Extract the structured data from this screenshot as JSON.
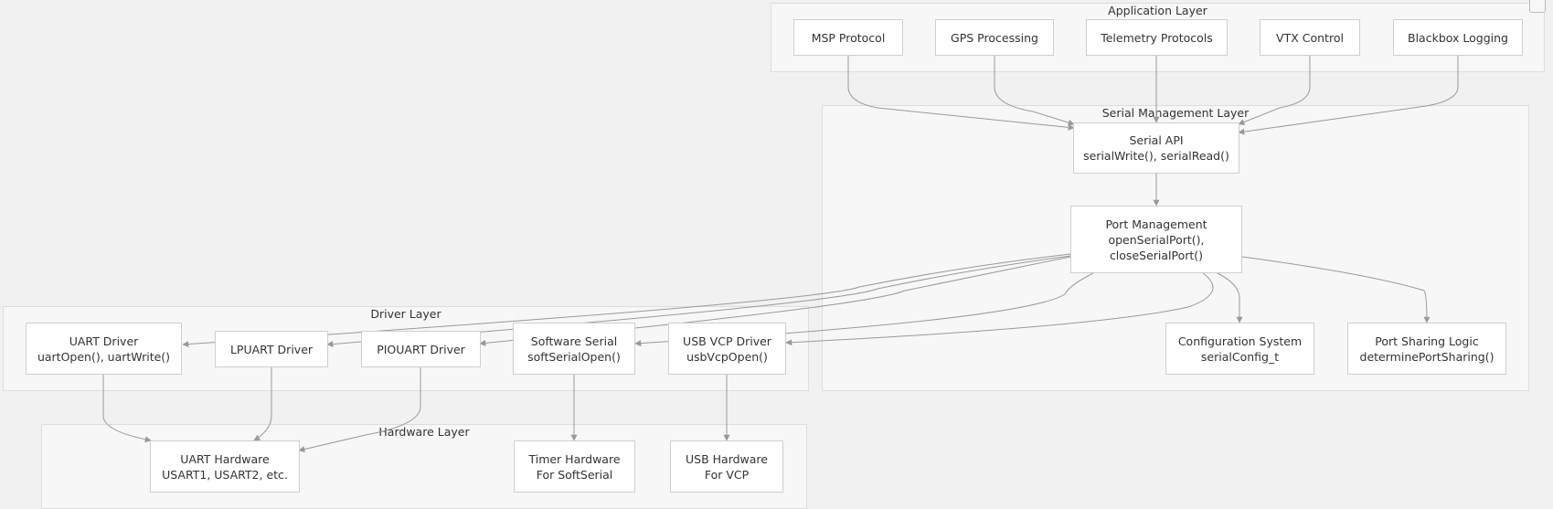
{
  "layers": {
    "application": "Application Layer",
    "serial_management": "Serial Management Layer",
    "driver": "Driver Layer",
    "hardware": "Hardware Layer"
  },
  "nodes": {
    "msp": [
      "MSP Protocol"
    ],
    "gps": [
      "GPS Processing"
    ],
    "telemetry": [
      "Telemetry Protocols"
    ],
    "vtx": [
      "VTX Control"
    ],
    "blackbox": [
      "Blackbox Logging"
    ],
    "serial_api": [
      "Serial API",
      "serialWrite(), serialRead()"
    ],
    "port_mgmt": [
      "Port Management",
      "openSerialPort(),",
      "closeSerialPort()"
    ],
    "config": [
      "Configuration System",
      "serialConfig_t"
    ],
    "sharing": [
      "Port Sharing Logic",
      "determinePortSharing()"
    ],
    "uart_drv": [
      "UART Driver",
      "uartOpen(), uartWrite()"
    ],
    "lpuart_drv": [
      "LPUART Driver"
    ],
    "piouart_drv": [
      "PIOUART Driver"
    ],
    "soft_serial": [
      "Software Serial",
      "softSerialOpen()"
    ],
    "usb_vcp": [
      "USB VCP Driver",
      "usbVcpOpen()"
    ],
    "uart_hw": [
      "UART Hardware",
      "USART1, USART2, etc."
    ],
    "timer_hw": [
      "Timer Hardware",
      "For SoftSerial"
    ],
    "usb_hw": [
      "USB Hardware",
      "For VCP"
    ]
  },
  "colors": {
    "edge": "#999999",
    "node_border": "#cfcfcf",
    "layer_bg": "#f7f7f7"
  }
}
